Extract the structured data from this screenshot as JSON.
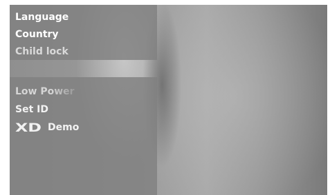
{
  "menu": {
    "items_top": [
      {
        "label": "Language"
      },
      {
        "label": "Country"
      },
      {
        "label": "Child lock"
      }
    ],
    "items_bottom": [
      {
        "label": "Low Power"
      },
      {
        "label": "Set ID"
      },
      {
        "label": "Demo",
        "logo_text": "XD",
        "logo_icon": "xd-logo-icon"
      }
    ]
  },
  "colors": {
    "menu_panel": "#808080",
    "text_active": "#ffffff",
    "text_dim": "#d9d9d9"
  }
}
